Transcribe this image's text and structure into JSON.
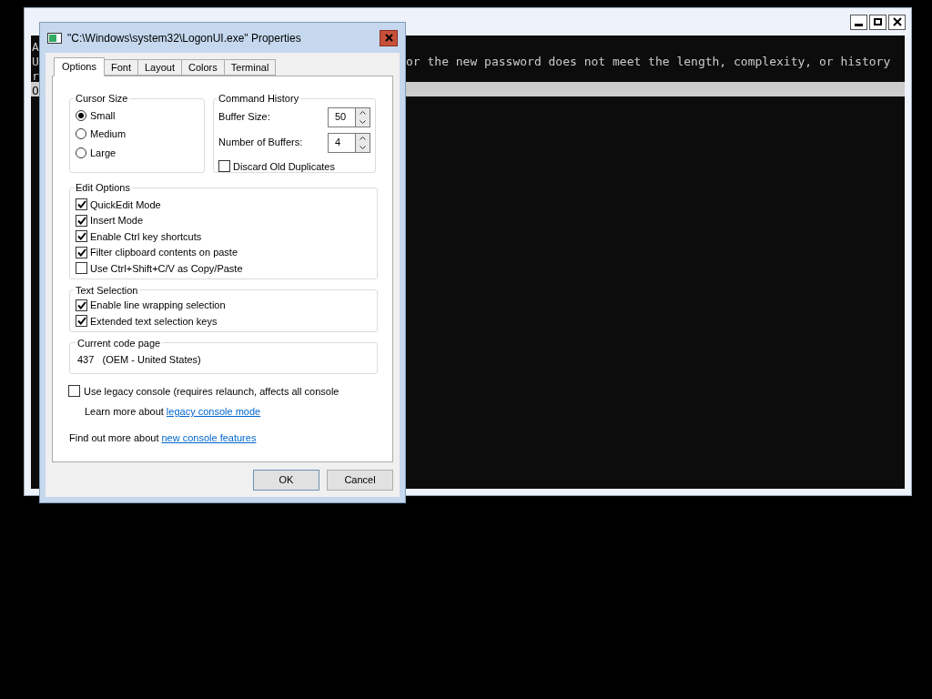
{
  "console_window": {
    "lines": [
      {
        "start": "A",
        "highlighted": false
      },
      {
        "start": "U",
        "rest": "or the new password does not meet the length, complexity, or history",
        "highlighted": false
      },
      {
        "start": "r",
        "highlighted": false
      },
      {
        "start": "O",
        "highlighted": true
      }
    ]
  },
  "dialog": {
    "title": "\"C:\\Windows\\system32\\LogonUI.exe\" Properties",
    "tabs": [
      {
        "label": "Options",
        "selected": true
      },
      {
        "label": "Font",
        "selected": false
      },
      {
        "label": "Layout",
        "selected": false
      },
      {
        "label": "Colors",
        "selected": false
      },
      {
        "label": "Terminal",
        "selected": false
      }
    ],
    "cursor_size": {
      "label": "Cursor Size",
      "options": [
        {
          "label": "Small",
          "selected": true
        },
        {
          "label": "Medium",
          "selected": false
        },
        {
          "label": "Large",
          "selected": false
        }
      ]
    },
    "command_history": {
      "label": "Command History",
      "fields": [
        {
          "label": "Buffer Size:",
          "value": "50"
        },
        {
          "label": "Number of Buffers:",
          "value": "4"
        }
      ],
      "discard": {
        "label": "Discard Old Duplicates",
        "checked": false
      }
    },
    "edit_options": {
      "label": "Edit Options",
      "items": [
        {
          "label": "QuickEdit Mode",
          "checked": true
        },
        {
          "label": "Insert Mode",
          "checked": true
        },
        {
          "label": "Enable Ctrl key shortcuts",
          "checked": true
        },
        {
          "label": "Filter clipboard contents on paste",
          "checked": true
        },
        {
          "label": "Use Ctrl+Shift+C/V as Copy/Paste",
          "checked": false
        }
      ]
    },
    "text_selection": {
      "label": "Text Selection",
      "items": [
        {
          "label": "Enable line wrapping selection",
          "checked": true
        },
        {
          "label": "Extended text selection keys",
          "checked": true
        }
      ]
    },
    "code_page": {
      "label": "Current code page",
      "value": "437   (OEM - United States)"
    },
    "legacy": {
      "label": "Use legacy console (requires relaunch, affects all console",
      "checked": false
    },
    "learn_more": {
      "text": "Learn more about",
      "link": "legacy console mode"
    },
    "find_out": {
      "text": "Find out more about",
      "link": "new console features"
    },
    "buttons": [
      {
        "label": "OK",
        "default": true
      },
      {
        "label": "Cancel",
        "default": false
      }
    ]
  }
}
